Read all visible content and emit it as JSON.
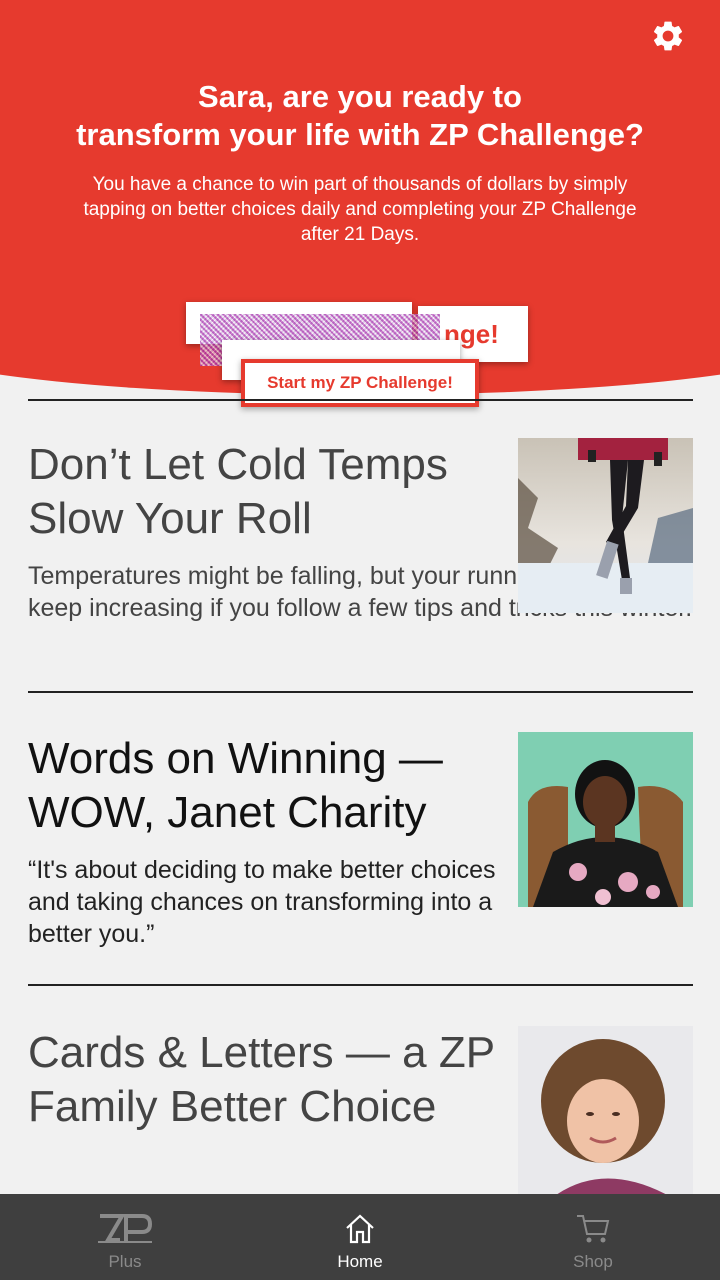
{
  "header": {
    "title_line1": "Sara, are you ready to",
    "title_line2": "transform your life with ZP Challenge?",
    "subtitle": "You have a chance to win part of thousands of dollars by simply tapping on better choices daily and completing your ZP Challenge after 21 Days.",
    "cta_label": "Start my ZP Challenge!",
    "cta_ghost_fragment": "nge!",
    "settings_icon": "gear-icon",
    "accent_color": "#e63a2e"
  },
  "feed": [
    {
      "title": "Don’t Let Cold Temps Slow Your Roll",
      "body": "Temperatures might be falling, but your running miles can keep increasing if you follow a few tips and tricks this winter.",
      "image": "runner-in-snow-photo"
    },
    {
      "title": "Words on Winning — WOW, Janet Charity",
      "body": "“It's about deciding to make better choices and taking chances on transforming into a better you.”",
      "image": "janet-charity-portrait"
    },
    {
      "title": "Cards & Letters — a ZP Family Better Choice",
      "image": "woman-portrait"
    }
  ],
  "nav": {
    "items": [
      {
        "label": "Plus",
        "icon": "zp-logo-icon",
        "active": false
      },
      {
        "label": "Home",
        "icon": "home-icon",
        "active": true
      },
      {
        "label": "Shop",
        "icon": "cart-icon",
        "active": false
      }
    ],
    "active_color": "#ffffff",
    "inactive_color": "#8a8a8a"
  }
}
